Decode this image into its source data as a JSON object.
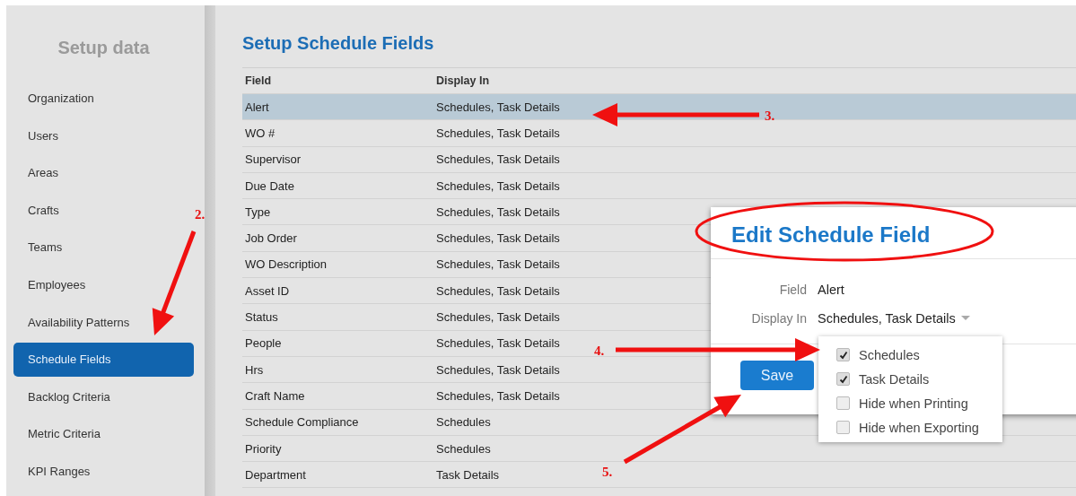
{
  "sidebar": {
    "title": "Setup data",
    "items": [
      {
        "label": "Organization",
        "selected": false
      },
      {
        "label": "Users",
        "selected": false
      },
      {
        "label": "Areas",
        "selected": false
      },
      {
        "label": "Crafts",
        "selected": false
      },
      {
        "label": "Teams",
        "selected": false
      },
      {
        "label": "Employees",
        "selected": false
      },
      {
        "label": "Availability Patterns",
        "selected": false
      },
      {
        "label": "Schedule Fields",
        "selected": true
      },
      {
        "label": "Backlog Criteria",
        "selected": false
      },
      {
        "label": "Metric Criteria",
        "selected": false
      },
      {
        "label": "KPI Ranges",
        "selected": false
      }
    ]
  },
  "page_title": "Setup Schedule Fields",
  "table": {
    "columns": [
      "Field",
      "Display In"
    ],
    "rows": [
      {
        "field": "Alert",
        "display_in": "Schedules, Task Details",
        "selected": true
      },
      {
        "field": "WO #",
        "display_in": "Schedules, Task Details",
        "selected": false
      },
      {
        "field": "Supervisor",
        "display_in": "Schedules, Task Details",
        "selected": false
      },
      {
        "field": "Due Date",
        "display_in": "Schedules, Task Details",
        "selected": false
      },
      {
        "field": "Type",
        "display_in": "Schedules, Task Details",
        "selected": false
      },
      {
        "field": "Job Order",
        "display_in": "Schedules, Task Details",
        "selected": false
      },
      {
        "field": "WO Description",
        "display_in": "Schedules, Task Details",
        "selected": false
      },
      {
        "field": "Asset ID",
        "display_in": "Schedules, Task Details",
        "selected": false
      },
      {
        "field": "Status",
        "display_in": "Schedules, Task Details",
        "selected": false
      },
      {
        "field": "People",
        "display_in": "Schedules, Task Details",
        "selected": false
      },
      {
        "field": "Hrs",
        "display_in": "Schedules, Task Details",
        "selected": false
      },
      {
        "field": "Craft Name",
        "display_in": "Schedules, Task Details",
        "selected": false
      },
      {
        "field": "Schedule Compliance",
        "display_in": "Schedules",
        "selected": false
      },
      {
        "field": "Priority",
        "display_in": "Schedules",
        "selected": false
      },
      {
        "field": "Department",
        "display_in": "Task Details",
        "selected": false
      }
    ]
  },
  "dialog": {
    "title": "Edit Schedule Field",
    "field_label": "Field",
    "field_value": "Alert",
    "display_label": "Display In",
    "display_value": "Schedules, Task Details",
    "save_button": "Save",
    "options": [
      {
        "label": "Schedules",
        "checked": true
      },
      {
        "label": "Task Details",
        "checked": true
      },
      {
        "label": "Hide when Printing",
        "checked": false
      },
      {
        "label": "Hide when Exporting",
        "checked": false
      }
    ]
  },
  "annotations": [
    "2.",
    "3.",
    "4.",
    "5."
  ]
}
